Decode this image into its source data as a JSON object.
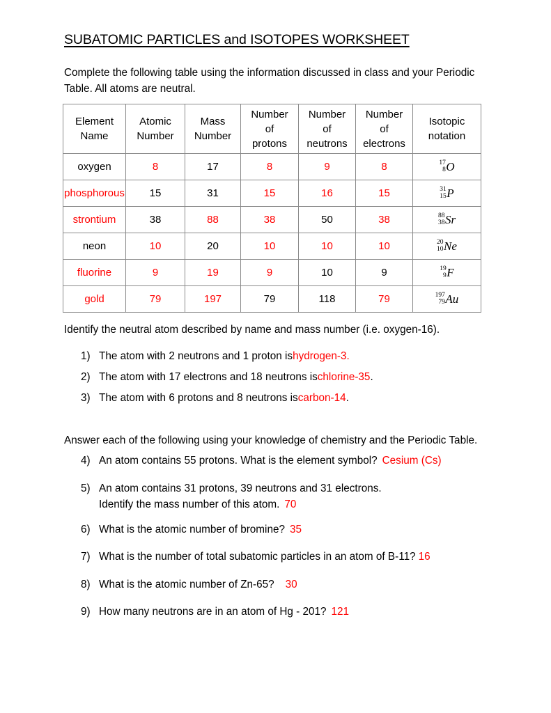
{
  "document": {
    "title": "SUBATOMIC PARTICLES and ISOTOPES WORKSHEET",
    "intro": "Complete the following table using the information discussed in class and your Periodic Table.  All atoms are neutral.",
    "answer_color": "#ff0000",
    "text_color": "#000000"
  },
  "table": {
    "headers": [
      "Element Name",
      "Atomic Number",
      "Mass Number",
      "Number of protons",
      "Number of neutrons",
      "Number of electrons",
      "Isotopic notation"
    ],
    "header_lines": [
      [
        "Element",
        "Name"
      ],
      [
        "Atomic",
        "Number"
      ],
      [
        "Mass",
        "Number"
      ],
      [
        "Number",
        "of",
        "protons"
      ],
      [
        "Number",
        "of",
        "neutrons"
      ],
      [
        "Number",
        "of",
        "electrons"
      ],
      [
        "Isotopic",
        "notation"
      ]
    ],
    "rows": [
      {
        "name": "oxygen",
        "name_color": "black",
        "atomic_number": "8",
        "atomic_number_color": "red",
        "mass_number": "17",
        "mass_number_color": "black",
        "protons": "8",
        "protons_color": "red",
        "neutrons": "9",
        "neutrons_color": "red",
        "electrons": "8",
        "electrons_color": "red",
        "isotope": {
          "mass": "17",
          "atomic": "8",
          "symbol": "O"
        }
      },
      {
        "name": "phosphorous",
        "name_color": "red",
        "atomic_number": "15",
        "atomic_number_color": "black",
        "mass_number": "31",
        "mass_number_color": "black",
        "protons": "15",
        "protons_color": "red",
        "neutrons": "16",
        "neutrons_color": "red",
        "electrons": "15",
        "electrons_color": "red",
        "isotope": {
          "mass": "31",
          "atomic": "15",
          "symbol": "P"
        }
      },
      {
        "name": "strontium",
        "name_color": "red",
        "atomic_number": "38",
        "atomic_number_color": "black",
        "mass_number": "88",
        "mass_number_color": "red",
        "protons": "38",
        "protons_color": "red",
        "neutrons": "50",
        "neutrons_color": "black",
        "electrons": "38",
        "electrons_color": "red",
        "isotope": {
          "mass": "88",
          "atomic": "38",
          "symbol": "Sr"
        }
      },
      {
        "name": "neon",
        "name_color": "black",
        "atomic_number": "10",
        "atomic_number_color": "red",
        "mass_number": "20",
        "mass_number_color": "black",
        "protons": "10",
        "protons_color": "red",
        "neutrons": "10",
        "neutrons_color": "red",
        "electrons": "10",
        "electrons_color": "red",
        "isotope": {
          "mass": "20",
          "atomic": "10",
          "symbol": "Ne"
        }
      },
      {
        "name": "fluorine",
        "name_color": "red",
        "atomic_number": "9",
        "atomic_number_color": "red",
        "mass_number": "19",
        "mass_number_color": "red",
        "protons": "9",
        "protons_color": "red",
        "neutrons": "10",
        "neutrons_color": "black",
        "electrons": "9",
        "electrons_color": "black",
        "isotope": {
          "mass": "19",
          "atomic": "9",
          "symbol": "F"
        }
      },
      {
        "name": "gold",
        "name_color": "red",
        "atomic_number": "79",
        "atomic_number_color": "red",
        "mass_number": "197",
        "mass_number_color": "red",
        "protons": "79",
        "protons_color": "black",
        "neutrons": "118",
        "neutrons_color": "black",
        "electrons": "79",
        "electrons_color": "red",
        "isotope": {
          "mass": "197",
          "atomic": "79",
          "symbol": "Au"
        }
      }
    ]
  },
  "section_identify": {
    "lead": "Identify the neutral atom described by name and mass number (i.e. oxygen-16).",
    "questions": [
      {
        "num": "1)",
        "text": "The atom with 2 neutrons and 1 proton is ",
        "answer": "hydrogen-3.",
        "trailing": ""
      },
      {
        "num": "2)",
        "text": "The atom with 17 electrons and 18 neutrons is ",
        "answer": "chlorine-35",
        "trailing": "."
      },
      {
        "num": "3)",
        "text": "The atom with 6 protons and 8 neutrons is ",
        "answer": "carbon-14",
        "trailing": "."
      }
    ]
  },
  "section_answer": {
    "lead": "Answer each of the following using your knowledge of chemistry and the Periodic Table.",
    "questions": [
      {
        "num": "4)",
        "text": "An atom contains 55 protons.  What is the element symbol?",
        "answer": "Cesium (Cs)"
      },
      {
        "num": "5)",
        "text": "An atom contains 31 protons, 39 neutrons and 31 electrons.",
        "line2": "Identify the mass number of this atom.",
        "answer": "70"
      },
      {
        "num": "6)",
        "text": "What is the atomic number of bromine?",
        "answer": "35"
      },
      {
        "num": "7)",
        "text": "What is the number of total subatomic particles in an atom of B-11?",
        "answer": "16"
      },
      {
        "num": "8)",
        "text": "What is the atomic number of Zn-65?",
        "answer": "30"
      },
      {
        "num": "9)",
        "text": "How many neutrons are in an atom of Hg - 201?",
        "answer": "121"
      }
    ]
  }
}
